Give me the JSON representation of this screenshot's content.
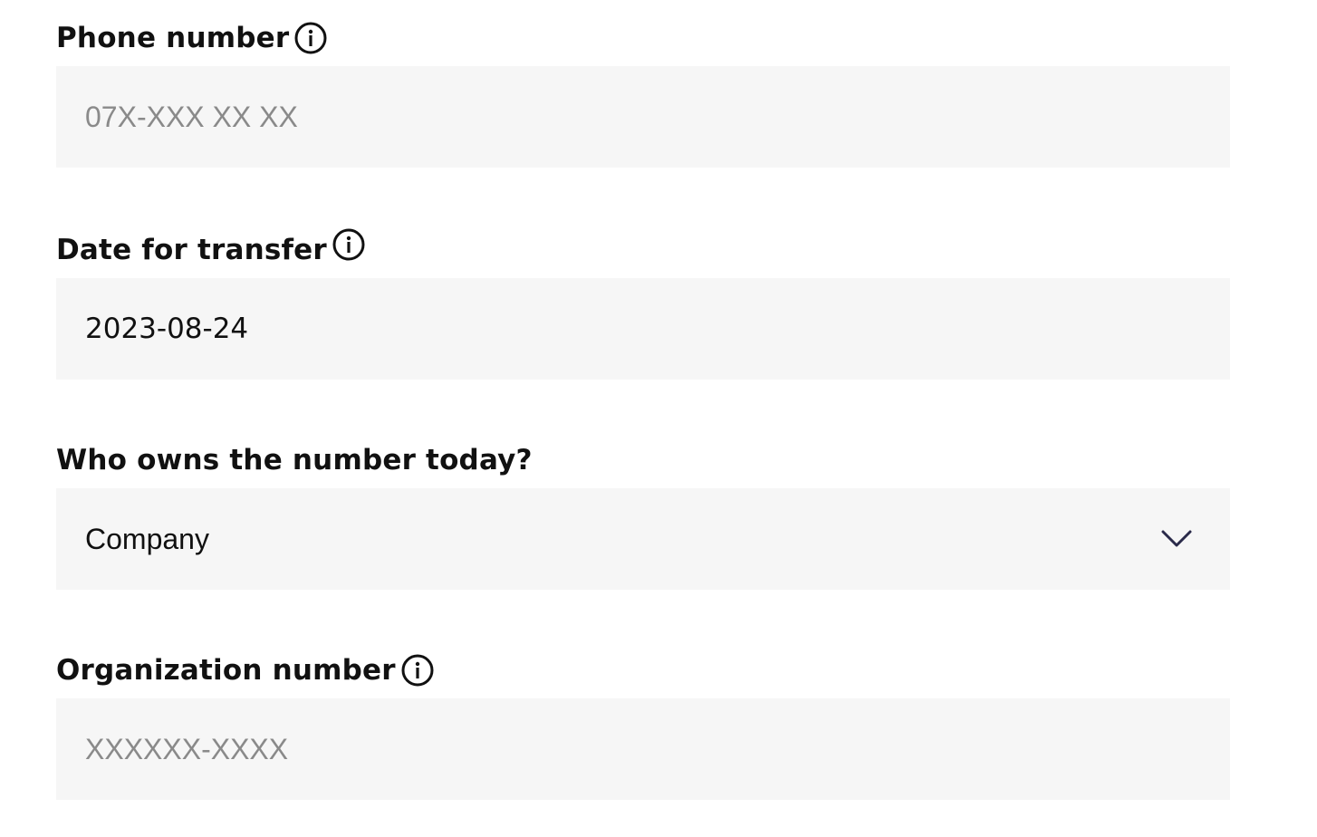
{
  "form": {
    "phone": {
      "label": "Phone number",
      "placeholder": "07X-XXX XX XX",
      "value": "",
      "info_icon": "info-circle-icon"
    },
    "transfer_date": {
      "label": "Date for transfer",
      "value": "2023-08-24",
      "info_icon": "info-circle-icon"
    },
    "owner": {
      "label": "Who owns the number today?",
      "selected": "Company",
      "icon": "chevron-down-icon"
    },
    "org_number": {
      "label": "Organization number",
      "placeholder": "XXXXXX-XXXX",
      "value": "",
      "info_icon": "info-circle-icon"
    }
  },
  "colors": {
    "input_background": "#f6f6f6",
    "label_text": "#111111",
    "placeholder_text": "#8a8a8a",
    "chevron": "#2a2a4a"
  }
}
